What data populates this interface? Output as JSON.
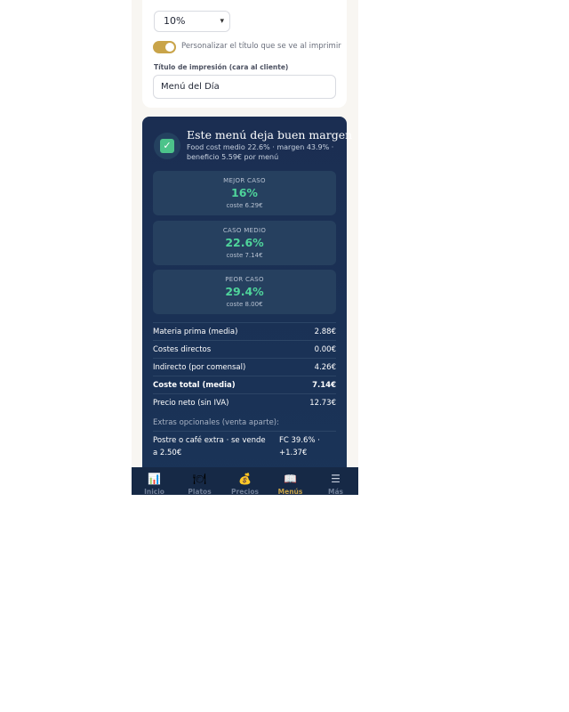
{
  "settings": {
    "margin_select_value": "10%",
    "toggle_label": "Personalizar el título que se ve al imprimir",
    "toggle_on": true,
    "print_title_label": "Título de impresión (cara al cliente)",
    "print_title_value": "Menú del Día"
  },
  "verdict": {
    "title": "Este menú deja buen margen",
    "subtitle": "Food cost medio 22.6% · margen 43.9% · beneficio 5.59€ por menú",
    "accent_color": "#4cc38a"
  },
  "scenarios": [
    {
      "label": "MEJOR CASO",
      "value": "16%",
      "cost": "coste 6.29€"
    },
    {
      "label": "CASO MEDIO",
      "value": "22.6%",
      "cost": "coste 7.14€"
    },
    {
      "label": "PEOR CASO",
      "value": "29.4%",
      "cost": "coste 8.00€"
    }
  ],
  "breakdown": [
    {
      "label": "Materia prima (media)",
      "value": "2.88€"
    },
    {
      "label": "Costes directos",
      "value": "0.00€"
    },
    {
      "label": "Indirecto (por comensal)",
      "value": "4.26€"
    },
    {
      "label": "Coste total (media)",
      "value": "7.14€"
    },
    {
      "label": "Precio neto (sin IVA)",
      "value": "12.73€"
    }
  ],
  "extras": {
    "title": "Extras opcionales (venta aparte):",
    "items": [
      {
        "label": "Postre o café extra · se vende a 2.50€",
        "value": "FC 39.6% · +1.37€"
      }
    ]
  },
  "nav": {
    "items": [
      {
        "label": "Inicio",
        "icon": "📊"
      },
      {
        "label": "Platos",
        "icon": "🍽"
      },
      {
        "label": "Precios",
        "icon": "💰"
      },
      {
        "label": "Menús",
        "icon": "📖"
      },
      {
        "label": "Más",
        "icon": "☰"
      }
    ],
    "active_color": "#c9a449"
  }
}
